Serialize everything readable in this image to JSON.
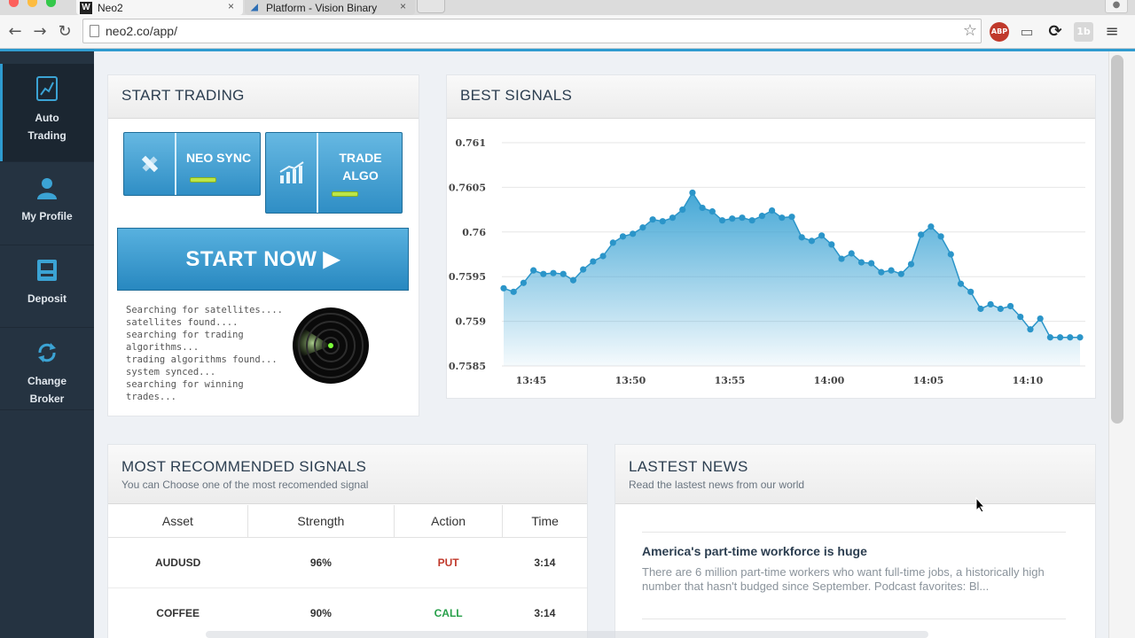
{
  "browser": {
    "tabs": [
      {
        "title": "Neo2",
        "favicon": "w-logo-icon"
      },
      {
        "title": "Platform - Vision Binary",
        "favicon": "platform-icon"
      }
    ],
    "tab_close_glyph": "×",
    "url": "neo2.co/app/",
    "ext_abp": "ABP",
    "ext_1b": "1b"
  },
  "sidebar": {
    "items": [
      {
        "label_line1": "Auto",
        "label_line2": "Trading",
        "icon": "chart-icon",
        "active": true
      },
      {
        "label_line1": "My Profile",
        "label_line2": "",
        "icon": "user-icon",
        "active": false
      },
      {
        "label_line1": "Deposit",
        "label_line2": "",
        "icon": "atm-icon",
        "active": false
      },
      {
        "label_line1": "Change",
        "label_line2": "Broker",
        "icon": "refresh-icon",
        "active": false
      }
    ]
  },
  "start_trading": {
    "title": "START TRADING",
    "neo_sync_label": "NEO SYNC",
    "trade_algo_line1": "TRADE",
    "trade_algo_line2": "ALGO",
    "start_now_label": "START NOW ▶",
    "console": "Searching for satellites....\nsatellites found....\nsearching for trading\nalgorithms...\ntrading algorithms found...\nsystem synced...\nsearching for winning\ntrades..."
  },
  "best_signals": {
    "title": "BEST SIGNALS"
  },
  "chart_data": {
    "type": "area",
    "title": "",
    "xlabel": "",
    "ylabel": "",
    "ylim": [
      0.7585,
      0.761
    ],
    "yticks": [
      "0.761",
      "0.7605",
      "0.76",
      "0.7595",
      "0.759",
      "0.7585"
    ],
    "xticks": [
      "13:45",
      "13:50",
      "13:55",
      "14:00",
      "14:05",
      "14:10"
    ],
    "grid": true,
    "color": "#3ba3d4",
    "series": [
      {
        "name": "",
        "values": [
          0.75937,
          0.75933,
          0.75943,
          0.75957,
          0.75953,
          0.75954,
          0.75953,
          0.75946,
          0.75958,
          0.75967,
          0.75973,
          0.75988,
          0.75995,
          0.75998,
          0.76005,
          0.76014,
          0.76012,
          0.76016,
          0.76025,
          0.76044,
          0.76027,
          0.76023,
          0.76013,
          0.76015,
          0.76016,
          0.76013,
          0.76018,
          0.76024,
          0.76016,
          0.76017,
          0.75994,
          0.7599,
          0.75996,
          0.75986,
          0.7597,
          0.75976,
          0.75966,
          0.75965,
          0.75955,
          0.75957,
          0.75953,
          0.75964,
          0.75997,
          0.76006,
          0.75995,
          0.75975,
          0.75942,
          0.75933,
          0.75914,
          0.75919,
          0.75914,
          0.75917,
          0.75905,
          0.75891,
          0.75903,
          0.75882,
          0.75882,
          0.75882,
          0.75882
        ]
      }
    ]
  },
  "recommended": {
    "title": "MOST RECOMMENDED SIGNALS",
    "subtitle": "You can Choose one of the most recomended signal",
    "columns": [
      "Asset",
      "Strength",
      "Action",
      "Time"
    ],
    "rows": [
      {
        "asset": "AUDUSD",
        "strength": "96%",
        "action": "PUT",
        "time": "3:14"
      },
      {
        "asset": "COFFEE",
        "strength": "90%",
        "action": "CALL",
        "time": "3:14"
      }
    ]
  },
  "news": {
    "title": "LASTEST NEWS",
    "subtitle": "Read the lastest news from our world",
    "items": [
      {
        "headline": "America's part-time workforce is huge",
        "body": "There are 6 million part-time workers who want full-time jobs, a historically high number that hasn't budged since September. Podcast favorites: Bl..."
      }
    ]
  }
}
